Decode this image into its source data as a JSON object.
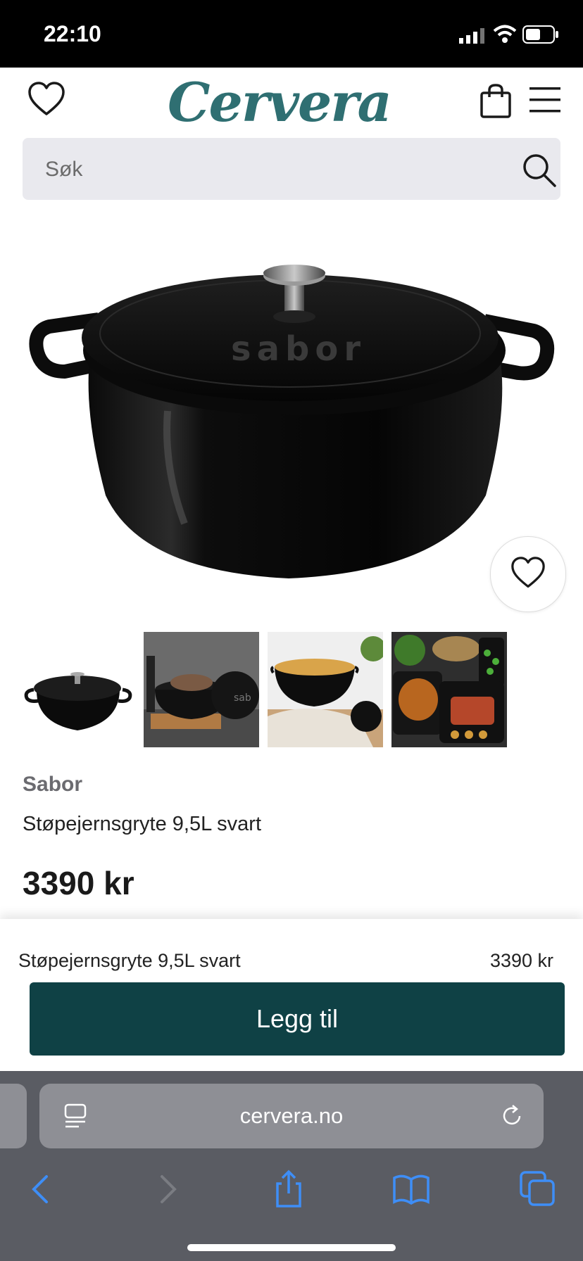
{
  "status_bar": {
    "time": "22:10"
  },
  "header": {
    "logo": "Cervera",
    "icons": [
      "heart-icon",
      "shopping-bag-icon",
      "hamburger-menu-icon"
    ]
  },
  "search": {
    "placeholder": "Søk",
    "icon": "search-icon"
  },
  "product": {
    "brand": "Sabor",
    "name": "Støpejernsgryte 9,5L svart",
    "price": "3390 kr",
    "wishlist_icon": "heart-icon"
  },
  "buy_bar": {
    "name": "Støpejernsgryte 9,5L svart",
    "price": "3390 kr",
    "button": "Legg til"
  },
  "browser": {
    "url": "cervera.no",
    "icons": [
      "tab-format-icon",
      "reload-icon",
      "back-icon",
      "forward-icon",
      "share-icon",
      "bookmarks-icon",
      "tabs-icon"
    ]
  },
  "colors": {
    "brand": "#2f6f72",
    "button": "#0f4145",
    "browser_accent": "#3e8ef7"
  }
}
